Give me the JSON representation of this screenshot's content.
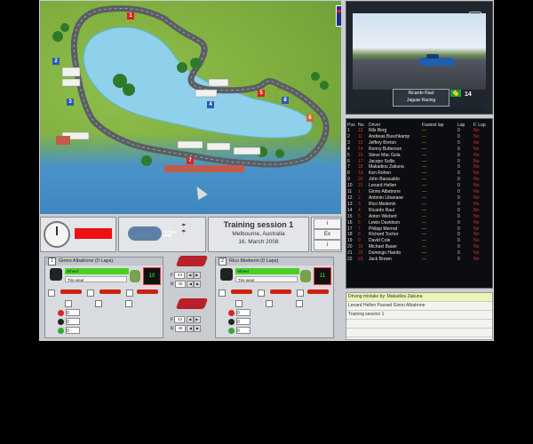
{
  "camera": {
    "top_label": "",
    "driver_name": "Ricardo Raul",
    "team_name": "Jaguar Racing",
    "position": "14",
    "zoom_icon": "magnifier-icon"
  },
  "standings": {
    "headers": {
      "pos": "Pos",
      "num": "No.",
      "driver": "Driver",
      "fastest": "Fastest lap",
      "lap": "Lap",
      "flap": "F. Lap"
    },
    "rows": [
      {
        "pos": "1",
        "num": "10",
        "driver": "Nils Berg",
        "fastest": "---",
        "lap": "0",
        "flap": "No"
      },
      {
        "pos": "2",
        "num": "11",
        "driver": "Andreas Buschkamp",
        "fastest": "---",
        "lap": "0",
        "flap": "No"
      },
      {
        "pos": "3",
        "num": "12",
        "driver": "Jeffery Breton",
        "fastest": "---",
        "lap": "0",
        "flap": "No"
      },
      {
        "pos": "4",
        "num": "14",
        "driver": "Ronny Butterson",
        "fastest": "---",
        "lap": "0",
        "flap": "No"
      },
      {
        "pos": "5",
        "num": "15",
        "driver": "Steve Mac Gola",
        "fastest": "---",
        "lap": "0",
        "flap": "No"
      },
      {
        "pos": "6",
        "num": "17",
        "driver": "Jacopo Sollis",
        "fastest": "---",
        "lap": "0",
        "flap": "No"
      },
      {
        "pos": "7",
        "num": "18",
        "driver": "Makadiou Zakuna",
        "fastest": "---",
        "lap": "0",
        "flap": "No"
      },
      {
        "pos": "8",
        "num": "19",
        "driver": "Ken Rohen",
        "fastest": "---",
        "lap": "0",
        "flap": "No"
      },
      {
        "pos": "9",
        "num": "20",
        "driver": "John Baracaldo",
        "fastest": "---",
        "lap": "0",
        "flap": "No"
      },
      {
        "pos": "10",
        "num": "21",
        "driver": "Lenard Hellen",
        "fastest": "---",
        "lap": "0",
        "flap": "No"
      },
      {
        "pos": "11",
        "num": "1",
        "driver": "Ginno Albatrone",
        "fastest": "---",
        "lap": "0",
        "flap": "No"
      },
      {
        "pos": "12",
        "num": "2",
        "driver": "Antonio Libanane",
        "fastest": "---",
        "lap": "0",
        "flap": "No"
      },
      {
        "pos": "13",
        "num": "3",
        "driver": "Rico Medenin",
        "fastest": "---",
        "lap": "0",
        "flap": "No"
      },
      {
        "pos": "14",
        "num": "4",
        "driver": "Ricardo Raul",
        "fastest": "---",
        "lap": "0",
        "flap": "No"
      },
      {
        "pos": "15",
        "num": "5",
        "driver": "Anton Wiebert",
        "fastest": "---",
        "lap": "0",
        "flap": "No"
      },
      {
        "pos": "16",
        "num": "6",
        "driver": "Lewis Davidson",
        "fastest": "---",
        "lap": "0",
        "flap": "No"
      },
      {
        "pos": "17",
        "num": "7",
        "driver": "Philipp Merrod",
        "fastest": "---",
        "lap": "0",
        "flap": "No"
      },
      {
        "pos": "18",
        "num": "8",
        "driver": "Richard Tocher",
        "fastest": "---",
        "lap": "0",
        "flap": "No"
      },
      {
        "pos": "19",
        "num": "9",
        "driver": "David Cole",
        "fastest": "---",
        "lap": "0",
        "flap": "No"
      },
      {
        "pos": "20",
        "num": "16",
        "driver": "Michael Bauer",
        "fastest": "---",
        "lap": "0",
        "flap": "No"
      },
      {
        "pos": "21",
        "num": "22",
        "driver": "Domingo Hairdo",
        "fastest": "---",
        "lap": "0",
        "flap": "No"
      },
      {
        "pos": "22",
        "num": "23",
        "driver": "Jack Brown",
        "fastest": "---",
        "lap": "0",
        "flap": "No"
      }
    ]
  },
  "log": {
    "messages": [
      "Driving mistake by: Makadiou Zakuna",
      "Lenard Hellen Passed Ginno Albatrone",
      "Training session 1",
      "",
      ""
    ]
  },
  "weather": {
    "temperature": "12°"
  },
  "session": {
    "title": "Training session 1",
    "location": "Melbourne, Australia",
    "date": "16. March 2008"
  },
  "mini_buttons": {
    "b1": "i",
    "b2": "Ex",
    "b3": "i"
  },
  "driver1": {
    "number": "1",
    "header": "Ginno Albatrone (0 Laps)",
    "status": "Wheel",
    "tire_label": "Tire wear",
    "fuel": "10"
  },
  "driver2": {
    "number": "2",
    "header": "Rico Medenin (0 Laps)",
    "status": "Wheel",
    "tire_label": "Tire wear",
    "fuel": "11"
  },
  "setup": {
    "front_label": "F",
    "rear_label": "R",
    "d1_front": "43",
    "d1_rear": "45",
    "d2_front": "43",
    "d2_rear": "45"
  },
  "track_markers": [
    "1",
    "2",
    "3",
    "4",
    "5",
    "6",
    "7",
    "8"
  ],
  "strategy": {
    "d1_values": [
      "0",
      "0",
      "0"
    ],
    "d2_values": [
      "0",
      "0",
      "0"
    ]
  },
  "colors": {
    "accent_red": "#ee1111",
    "status_green": "#45d320",
    "highlight": "#ecf3b4"
  }
}
